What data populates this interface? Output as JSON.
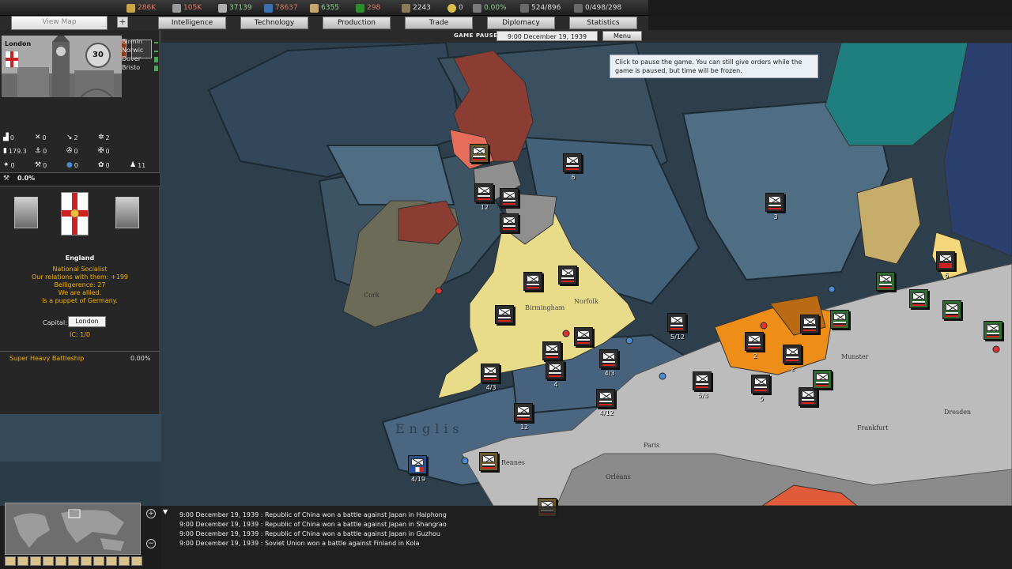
{
  "resources": [
    {
      "name": "energy",
      "value": "286K",
      "color": "#d97a6a",
      "icon": "energy-icon"
    },
    {
      "name": "metal",
      "value": "105K",
      "color": "#d97a6a",
      "icon": "metal-icon"
    },
    {
      "name": "rare-materials",
      "value": "37139",
      "color": "#8fd08f",
      "icon": "rare-materials-icon"
    },
    {
      "name": "crude-oil",
      "value": "78637",
      "color": "#d97a6a",
      "icon": "crude-oil-icon"
    },
    {
      "name": "supplies",
      "value": "6355",
      "color": "#8fd08f",
      "icon": "supplies-icon"
    },
    {
      "name": "money",
      "value": "298",
      "color": "#d97a6a",
      "icon": "money-icon"
    },
    {
      "name": "manpower",
      "value": "2243",
      "color": "#dddddd",
      "icon": "manpower-icon"
    },
    {
      "name": "nukes",
      "value": "0",
      "color": "#dddddd",
      "icon": "nuke-icon"
    },
    {
      "name": "dissent",
      "value": "0.00%",
      "color": "#8fd08f",
      "icon": "dissent-icon"
    },
    {
      "name": "transports",
      "value": "524/896",
      "color": "#dddddd",
      "icon": "transport-icon"
    },
    {
      "name": "escorts",
      "value": "0/498/298",
      "color": "#dddddd",
      "icon": "escort-icon"
    }
  ],
  "tabs": {
    "view_map": "View Map",
    "intelligence": "Intelligence",
    "technology": "Technology",
    "production": "Production",
    "trade": "Trade",
    "diplomacy": "Diplomacy",
    "statistics": "Statistics"
  },
  "timebar": {
    "status": "GAME PAUSED",
    "date": "9:00 December 19, 1939",
    "menu": "Menu"
  },
  "province": {
    "name": "London",
    "badge": "30",
    "neighbors": [
      "Birmin",
      "Norwic",
      "Dover",
      "Bristo"
    ],
    "stats_row1": [
      "0",
      "0",
      "2",
      "2"
    ],
    "stats_row2": [
      "179.3",
      "0",
      "0",
      "0"
    ],
    "stats_row3": [
      "0",
      "0",
      "0",
      "0",
      "11"
    ],
    "ic_value": "0.0%"
  },
  "country": {
    "name": "England",
    "ideology": "National Socialist",
    "relations": "Our relations with them: +199",
    "belligerence": "Belligerence: 27",
    "allied": "We are allied.",
    "puppet": "Is a puppet of Germany.",
    "capital_label": "Capital:",
    "capital": "London",
    "ic": "IC: 1/0"
  },
  "tech": {
    "name": "Super Heavy Battleship",
    "progress": "0.00%"
  },
  "tooltip": "Click to pause the game. You can still give orders while the game is paused, but time will be frozen.",
  "log": [
    "9:00 December 19, 1939 : Republic of China won a battle against Japan in Haiphong",
    "9:00 December 19, 1939 : Republic of China won a battle against Japan in Shangrao",
    "9:00 December 19, 1939 : Republic of China won a battle against Japan in Guzhou",
    "9:00 December 19, 1939 : Soviet Union won a battle against Finland in Kola"
  ],
  "unit_labels": {
    "u1": "12",
    "u2": "6",
    "u3": "3",
    "u4": "4/3",
    "u5": "4/3",
    "u6": "4",
    "u7": "4/12",
    "u8": "12",
    "u9": "5/12",
    "u10": "5/3",
    "u11": "4/19",
    "u12": "5",
    "u13": "2",
    "u14": "6",
    "u15": "2"
  },
  "map_text": {
    "birmingham": "Birmingham",
    "norfolk": "Norfolk",
    "cork": "Cork",
    "english_channel": "Englis",
    "rennes": "Rennes",
    "orleans": "Orléans",
    "paris": "Paris",
    "munster": "Munster",
    "frankfurt": "Frankfurt",
    "dresden": "Dresden"
  }
}
